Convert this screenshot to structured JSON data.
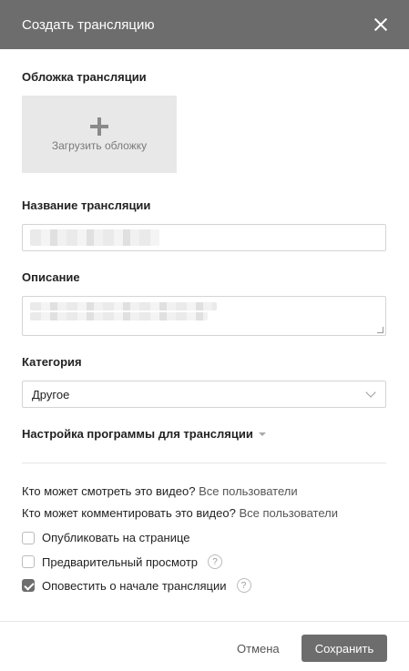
{
  "header": {
    "title": "Создать трансляцию"
  },
  "cover": {
    "label": "Обложка трансляции",
    "upload_text": "Загрузить обложку"
  },
  "name": {
    "label": "Название трансляции"
  },
  "description": {
    "label": "Описание"
  },
  "category": {
    "label": "Категория",
    "selected": "Другое"
  },
  "program_settings": {
    "label": "Настройка программы для трансляции"
  },
  "privacy": {
    "view_question": "Кто может смотреть это видео?",
    "view_value": "Все пользователи",
    "comment_question": "Кто может комментировать это видео?",
    "comment_value": "Все пользователи"
  },
  "options": {
    "publish": {
      "label": "Опубликовать на странице",
      "checked": false
    },
    "preview": {
      "label": "Предварительный просмотр",
      "checked": false,
      "help": "?"
    },
    "notify": {
      "label": "Оповестить о начале трансляции",
      "checked": true,
      "help": "?"
    }
  },
  "footer": {
    "cancel_label": "Отмена",
    "save_label": "Сохранить"
  }
}
